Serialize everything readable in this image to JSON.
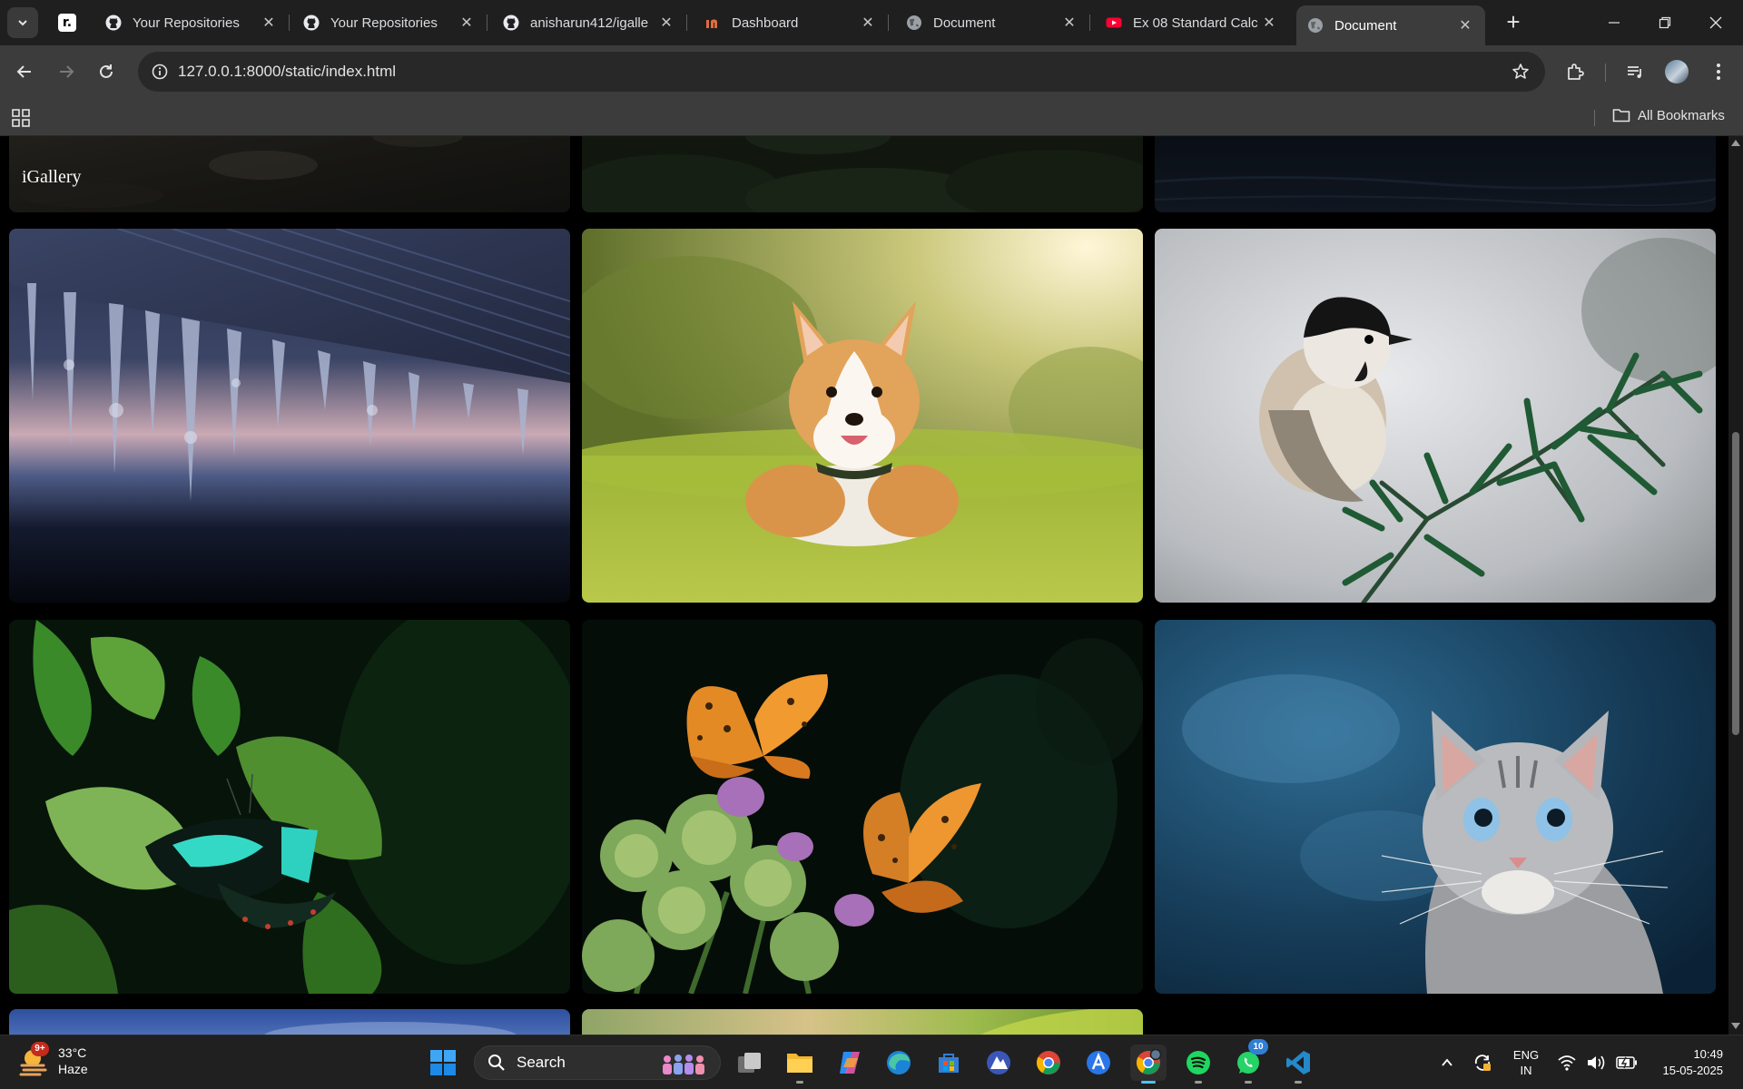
{
  "browser": {
    "tabs": [
      {
        "title": "Your Repositories",
        "icon": "github-icon"
      },
      {
        "title": "Your Repositories",
        "icon": "github-icon"
      },
      {
        "title": "anisharun412/igalle",
        "icon": "github-icon"
      },
      {
        "title": "Dashboard",
        "icon": "dashboard-icon"
      },
      {
        "title": "Document",
        "icon": "globe-icon"
      },
      {
        "title": "Ex 08 Standard Calc",
        "icon": "youtube-icon"
      },
      {
        "title": "Document",
        "icon": "globe-icon",
        "active": true
      }
    ],
    "pinned_tab_icon": "pinned-site-icon",
    "pinned_tab_glyph": "r.",
    "new_tab_label": "+",
    "url": "127.0.0.1:8000/static/index.html",
    "bookmarks_label": "All Bookmarks"
  },
  "page": {
    "site_title": "iGallery",
    "images": [
      {
        "subject": "rocky shore"
      },
      {
        "subject": "forest treetops"
      },
      {
        "subject": "dark water"
      },
      {
        "subject": "icicles at dusk"
      },
      {
        "subject": "corgi in grass"
      },
      {
        "subject": "chickadee on branch"
      },
      {
        "subject": "green swallowtail butterfly"
      },
      {
        "subject": "orange butterflies on thistle"
      },
      {
        "subject": "grey tabby kitten"
      },
      {
        "subject": "sky"
      },
      {
        "subject": "plant leaves"
      }
    ]
  },
  "taskbar": {
    "weather": {
      "temp": "33°C",
      "condition": "Haze",
      "badge": "9+"
    },
    "search_label": "Search",
    "whatsapp_badge": "10",
    "lang_top": "ENG",
    "lang_bottom": "IN",
    "time": "10:49",
    "date": "15-05-2025"
  },
  "colors": {
    "tab_strip": "#1f1f1f",
    "toolbar": "#3c3c3c",
    "omnibox": "#282828",
    "page_bg": "#000000",
    "taskbar": "#202020",
    "accent": "#4cc2ff"
  }
}
